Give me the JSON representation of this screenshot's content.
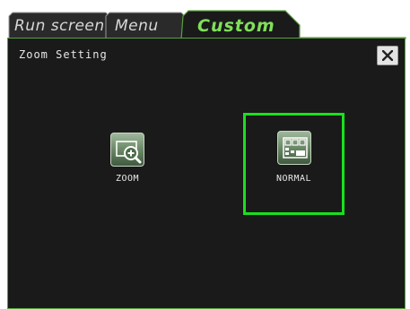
{
  "tabs": [
    {
      "label": "Run screen",
      "active": false
    },
    {
      "label": "Menu",
      "active": false
    },
    {
      "label": "Custom",
      "active": true
    }
  ],
  "dialog": {
    "title": "Zoom Setting",
    "close_icon": "close-icon"
  },
  "options": [
    {
      "label": "ZOOM",
      "icon": "zoom-in-icon",
      "selected": false
    },
    {
      "label": "NORMAL",
      "icon": "normal-layout-icon",
      "selected": true
    }
  ],
  "colors": {
    "selection": "#19e01e",
    "active_tab": "#7fe05a",
    "panel_border": "#5aa040",
    "panel_background": "#1a1a1a"
  }
}
